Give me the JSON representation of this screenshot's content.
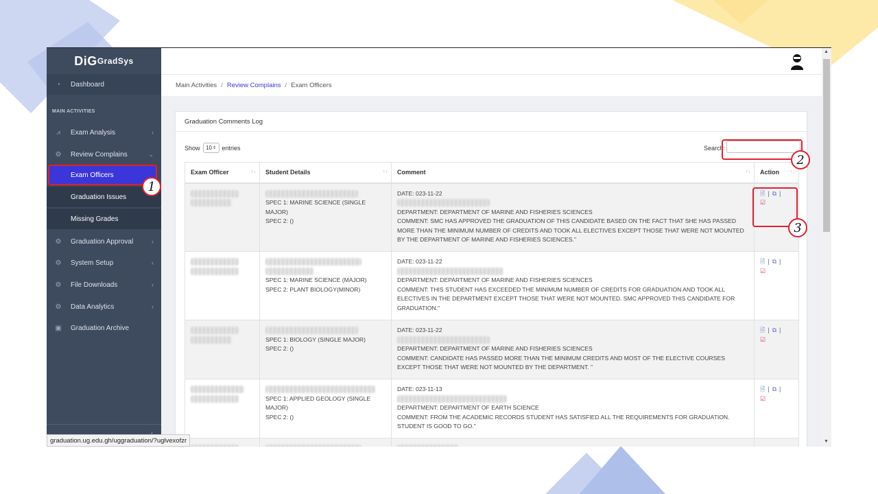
{
  "app": {
    "brand_prefix": "DiG",
    "brand_suffix": "radSys",
    "status_url": "graduation.ug.edu.gh/uggraduation/?uglvexofzr"
  },
  "sidebar": {
    "dashboard": "Dashboard",
    "section_title": "MAIN ACTIVITIES",
    "items": [
      {
        "label": "Exam Analysis",
        "icon": "chart-line-icon"
      },
      {
        "label": "Review Complains",
        "icon": "gear-icon"
      },
      {
        "label": "Graduation Approval",
        "icon": "gear-icon"
      },
      {
        "label": "System Setup",
        "icon": "gear-icon"
      },
      {
        "label": "File Downloads",
        "icon": "gear-icon"
      },
      {
        "label": "Data Analytics",
        "icon": "gear-icon"
      },
      {
        "label": "Graduation Archive",
        "icon": "archive-icon"
      }
    ],
    "sub_items": [
      "Exam Officers",
      "Graduation Issues",
      "Missing Grades"
    ]
  },
  "breadcrumb": {
    "root": "Main Activities",
    "middle": "Review Complains",
    "current": "Exam Officers",
    "separator": "/"
  },
  "card": {
    "title": "Graduation Comments Log",
    "show_label": "Show",
    "entries_value": "10",
    "entries_label": "entries",
    "search_label": "Search:"
  },
  "table": {
    "headers": [
      "Exam Officer",
      "Student Details",
      "Comment",
      "Action"
    ],
    "rows": [
      {
        "spec1": "SPEC 1: MARINE SCIENCE (SINGLE MAJOR)",
        "spec2": "SPEC 2: ()",
        "date": "DATE: 023-11-22",
        "dept": "DEPARTMENT: DEPARTMENT OF MARINE AND FISHERIES SCIENCES",
        "comment": "COMMENT: SMC HAS APPROVED THE GRADUATION OF THIS CANDIDATE BASED ON THE FACT THAT SHE HAS PASSED MORE THAN THE MINIMUM NUMBER OF CREDITS AND TOOK ALL ELECTIVES EXCEPT THOSE THAT WERE NOT MOUNTED BY THE DEPARTMENT OF MARINE AND FISHERIES SCIENCES.\""
      },
      {
        "spec1": "SPEC 1: MARINE SCIENCE (MAJOR)",
        "spec2": "SPEC 2: PLANT BIOLOGY(MINOR)",
        "date": "DATE: 023-11-22",
        "dept": "DEPARTMENT: DEPARTMENT OF MARINE AND FISHERIES SCIENCES",
        "comment": "COMMENT: THIS STUDENT HAS EXCEEDED THE MINIMUM NUMBER OF CREDITS FOR GRADUATION AND TOOK ALL ELECTIVES IN THE DEPARTMENT EXCEPT THOSE THAT WERE NOT MOUNTED. SMC APPROVED THIS CANDIDATE FOR GRADUATION.\""
      },
      {
        "spec1": "SPEC 1: BIOLOGY (SINGLE MAJOR)",
        "spec2": "SPEC 2: ()",
        "date": "DATE: 023-11-22",
        "dept": "DEPARTMENT: DEPARTMENT OF MARINE AND FISHERIES SCIENCES",
        "comment": "COMMENT: CANDIDATE HAS PASSED MORE THAN THE MINIMUM CREDITS AND MOST OF THE ELECTIVE COURSES EXCEPT THOSE THAT WERE NOT MOUNTED BY THE DEPARTMENT. \""
      },
      {
        "spec1": "SPEC 1: APPLIED GEOLOGY (SINGLE MAJOR)",
        "spec2": "SPEC 2: ()",
        "date": "DATE: 023-11-13",
        "dept": "DEPARTMENT: DEPARTMENT OF EARTH SCIENCE",
        "comment": "COMMENT: FROM THE ACADEMIC RECORDS STUDENT HAS SATISFIED ALL THE REQUIREMENTS FOR GRADUATION. STUDENT IS GOOD TO GO.\""
      }
    ]
  },
  "callouts": [
    "1",
    "2",
    "3"
  ],
  "colors": {
    "sidebar_bg": "#3e4a5e",
    "active_item": "#3a36d9",
    "callout_red": "#e0202e",
    "link_blue": "#3a3ad8",
    "deco_blue": "#c9d3ef",
    "deco_yellow": "#fde9a8"
  }
}
